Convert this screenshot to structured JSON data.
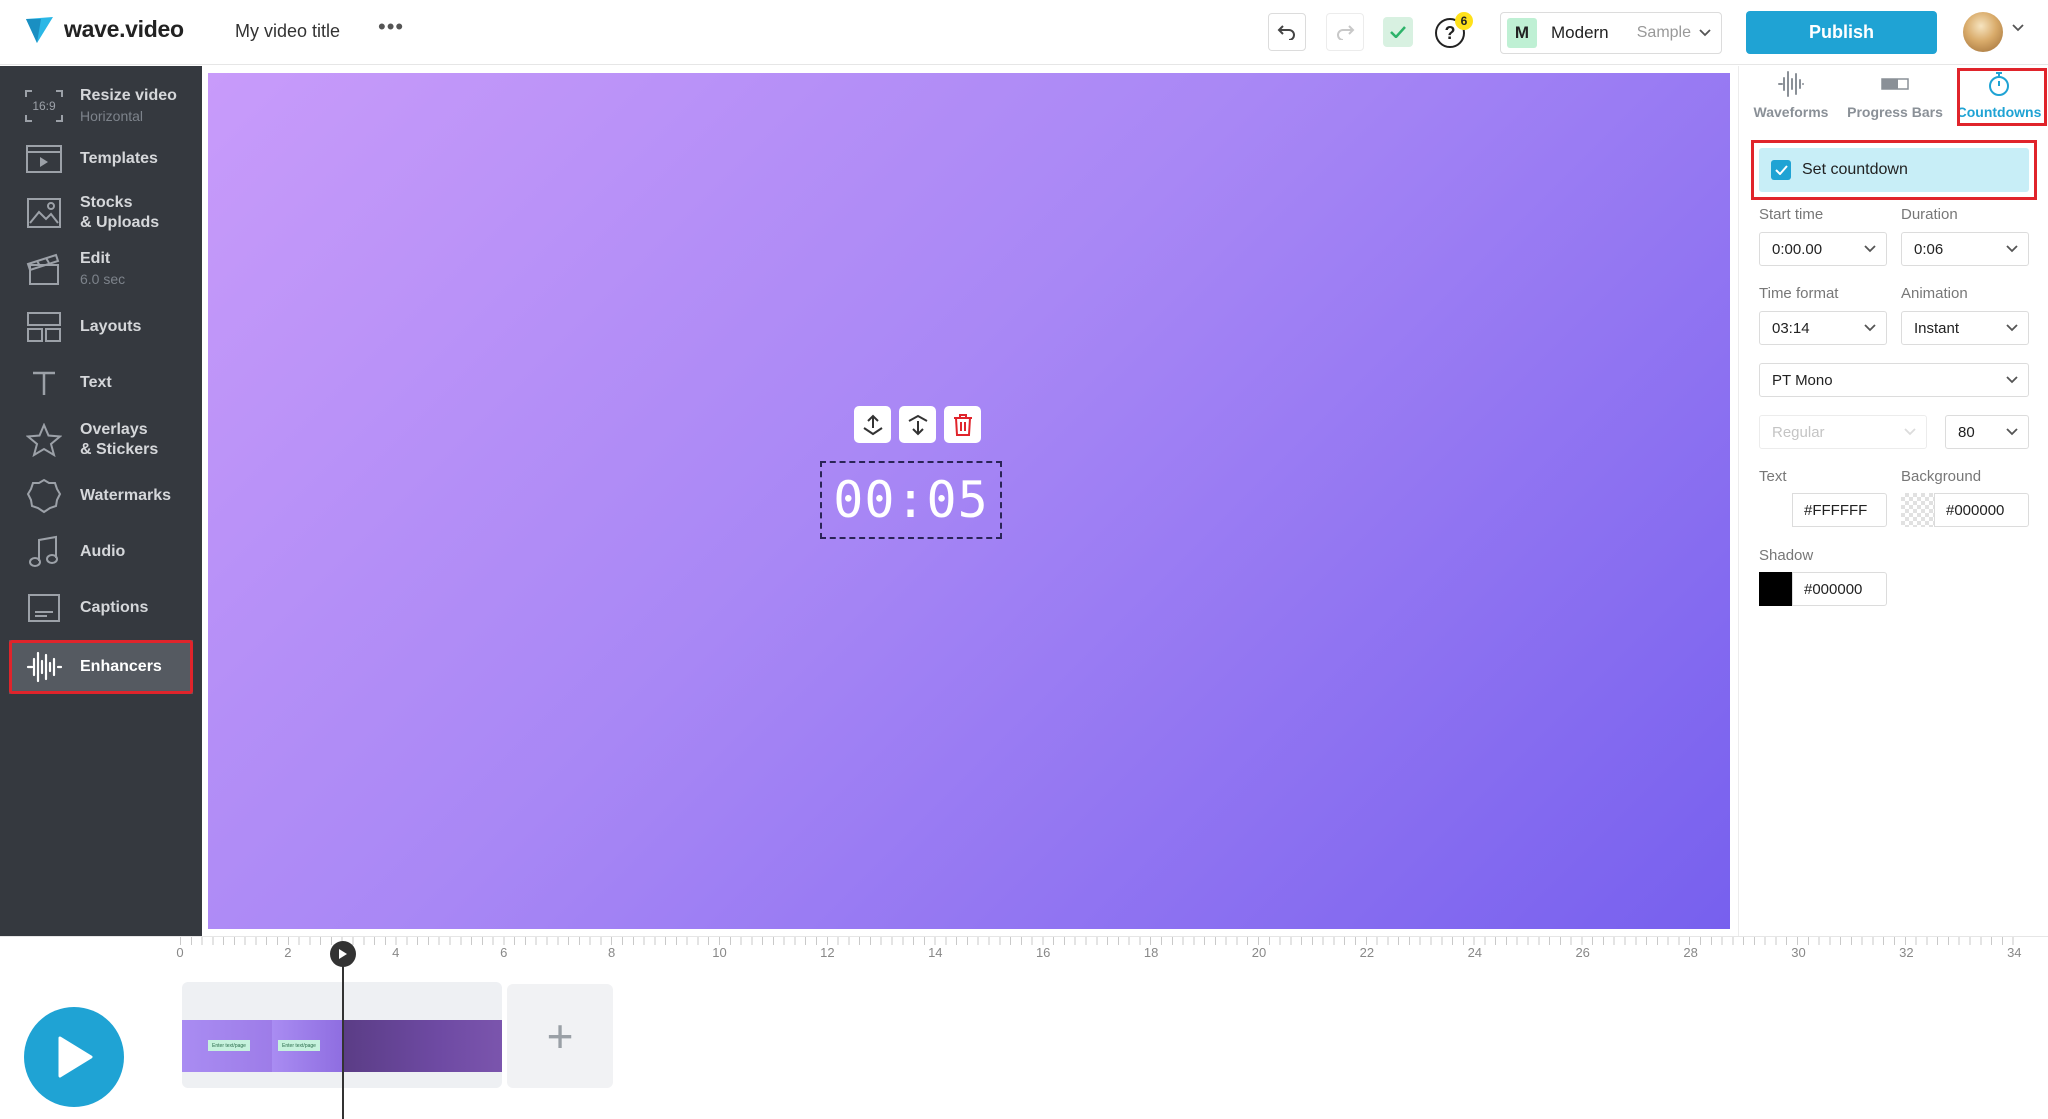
{
  "header": {
    "logo_text": "wave.video",
    "video_title": "My video title",
    "more": "•••",
    "help_badge": "6",
    "style": {
      "initial": "M",
      "name": "Modern",
      "sample": "Sample"
    },
    "publish_label": "Publish"
  },
  "sidebar": {
    "items": [
      {
        "label": "Resize video",
        "sub": "Horizontal",
        "icon": "resize-16-9-icon",
        "icon_text": "16:9"
      },
      {
        "label": "Templates",
        "icon": "templates-icon"
      },
      {
        "label": "Stocks",
        "label2": "& Uploads",
        "icon": "image-icon"
      },
      {
        "label": "Edit",
        "sub": "6.0 sec",
        "icon": "clapperboard-icon"
      },
      {
        "label": "Layouts",
        "icon": "layouts-icon"
      },
      {
        "label": "Text",
        "icon": "text-icon"
      },
      {
        "label": "Overlays",
        "label2": "& Stickers",
        "icon": "star-icon"
      },
      {
        "label": "Watermarks",
        "icon": "watermark-icon"
      },
      {
        "label": "Audio",
        "icon": "music-note-icon"
      },
      {
        "label": "Captions",
        "icon": "captions-icon"
      },
      {
        "label": "Enhancers",
        "icon": "waveform-icon",
        "active": true
      }
    ]
  },
  "canvas": {
    "countdown_text": "00:05"
  },
  "panel": {
    "tabs": [
      {
        "label": "Waveforms",
        "icon": "waveform-icon"
      },
      {
        "label": "Progress Bars",
        "icon": "progress-bar-icon"
      },
      {
        "label": "Countdowns",
        "icon": "stopwatch-icon",
        "active": true
      }
    ],
    "set_countdown_label": "Set countdown",
    "set_countdown_checked": true,
    "start_time_label": "Start time",
    "start_time_value": "0:00.00",
    "duration_label": "Duration",
    "duration_value": "0:06",
    "time_format_label": "Time format",
    "time_format_value": "03:14",
    "animation_label": "Animation",
    "animation_value": "Instant",
    "font_value": "PT Mono",
    "weight_value": "Regular",
    "size_value": "80",
    "text_label": "Text",
    "text_color": "#FFFFFF",
    "background_label": "Background",
    "background_color": "#000000",
    "shadow_label": "Shadow",
    "shadow_color": "#000000"
  },
  "timeline": {
    "ticks": [
      "0",
      "2",
      "4",
      "6",
      "8",
      "10",
      "12",
      "14",
      "16",
      "18",
      "20",
      "22",
      "24",
      "26",
      "28",
      "30",
      "32",
      "34"
    ],
    "clip_tag_text": "Enter text/page"
  },
  "colors": {
    "accent": "#1fa3d4",
    "sidebar_bg": "#35393f",
    "highlight": "#e0242b",
    "canvas_start": "#c89bfa",
    "canvas_end": "#7760ee"
  }
}
